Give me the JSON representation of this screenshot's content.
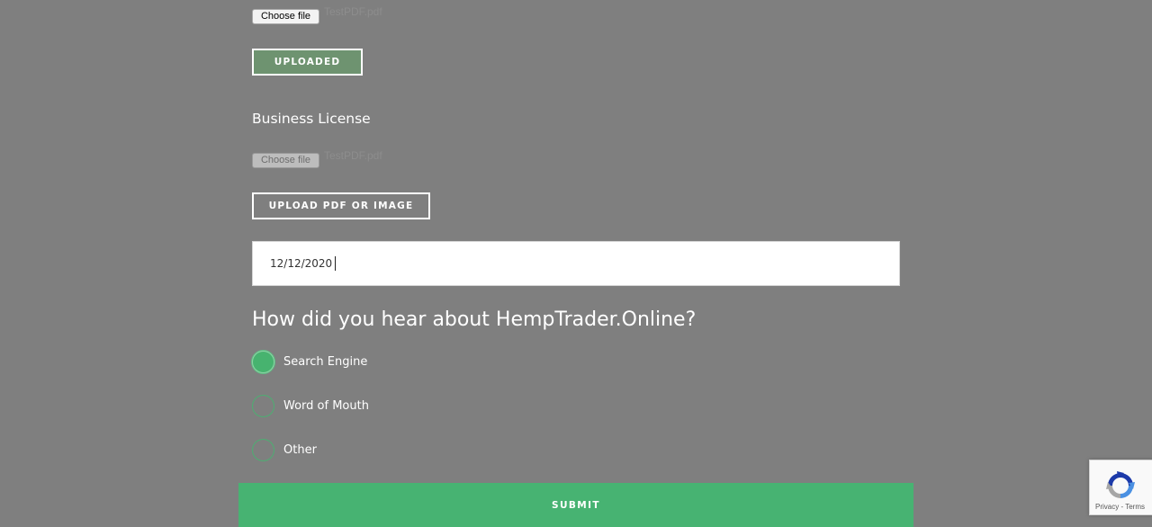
{
  "license_upload_1": {
    "choose_label": "Choose file",
    "file_name": "TestPDF.pdf",
    "status_button": "UPLOADED"
  },
  "business_license": {
    "label": "Business License",
    "choose_label": "Choose file",
    "file_name": "TestPDF.pdf",
    "upload_button": "UPLOAD PDF OR IMAGE"
  },
  "expiration_date": {
    "value": "12/12/2020"
  },
  "referral": {
    "question": "How did you hear about HempTrader.Online?",
    "options": [
      {
        "label": "Search Engine",
        "checked": true
      },
      {
        "label": "Word of Mouth",
        "checked": false
      },
      {
        "label": "Other",
        "checked": false
      }
    ]
  },
  "submit": {
    "label": "SUBMIT"
  },
  "recaptcha": {
    "privacy": "Privacy",
    "separator": " - ",
    "terms": "Terms"
  },
  "colors": {
    "background": "#7f7f7f",
    "accent_green": "#47b372",
    "uploaded_fill": "#6e9370"
  },
  "icons": {
    "recaptcha": "recaptcha-logo-icon"
  }
}
